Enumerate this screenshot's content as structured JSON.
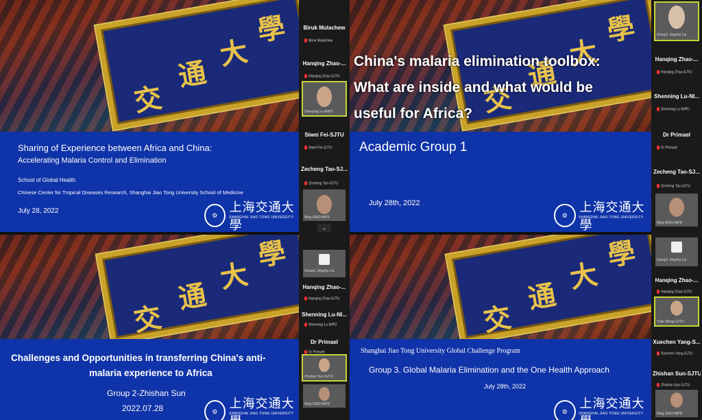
{
  "slides": {
    "s1": {
      "plaque_chars": [
        "交",
        "通",
        "大",
        "學"
      ],
      "title_line1": "Sharing of Experience between Africa and China:",
      "title_line2": "Accelerating Malaria Control and Elimination",
      "org1": "School of Global Health",
      "org2": "Chinese Center for Tropical Diseases Research, Shanghai Jiao Tong University School of Medicine",
      "date": "July 28, 2022",
      "logo_cn": "上海交通大學",
      "logo_en": "SHANGHAI JIAO TONG UNIVERSITY"
    },
    "s2": {
      "plaque_chars": [
        "交",
        "通",
        "大",
        "學"
      ],
      "overlay_line1": "China's malaria elimination toolbox:",
      "overlay_line2": "What are inside and what would be",
      "overlay_line3": "useful for Africa?",
      "group": "Academic Group 1",
      "date": "July 28th, 2022",
      "logo_cn": "上海交通大學",
      "logo_en": "SHANGHAI JIAO TONG UNIVERSITY"
    },
    "s3": {
      "plaque_chars": [
        "交",
        "通",
        "大",
        "學"
      ],
      "title_line1": "Challenges and Opportunities in transferring China's anti-",
      "title_line2": "malaria experience to Africa",
      "presenter": "Group 2-Zhishan Sun",
      "date": "2022.07.28",
      "logo_cn": "上海交通大學",
      "logo_en": "SHANGHAI JIAO TONG UNIVERSITY"
    },
    "s4": {
      "plaque_chars": [
        "交",
        "通",
        "大",
        "學"
      ],
      "program": "Shanghai Jiao Tong University Global Challenge Program",
      "title": "Group 3. Global Malaria Elimination and the One Health Approach",
      "date": "July 28th, 2022",
      "logo_cn": "上海交通大學",
      "logo_en": "SHANGHAI JIAO TONG UNIVERSITY"
    }
  },
  "strip1": {
    "participants": [
      {
        "name": "Biruk Mulachew",
        "label": "Biruk Mulachew"
      },
      {
        "name": "Hanqing Zhao-...",
        "label": "Hanqing Zhao-SJTU"
      },
      {
        "label": "Shenning Lu-NIPD"
      },
      {
        "name": "Siwei Fei-SJTU",
        "label": "Siwei Fei-SJTU"
      },
      {
        "name": "Zecheng Tao-SJ...",
        "label": "Zecheng Tao-SJTU"
      },
      {
        "label": "Ning XIAO-NIPD"
      },
      {
        "label": "Group1 Jingshu Liu"
      },
      {
        "name": "Hanqing Zhao-...",
        "label": "Hanqing Zhao-SJTU"
      },
      {
        "name": "Shenning Lu-NI...",
        "label": "Shenning Lu-NIPD"
      },
      {
        "name": "Dr Primael",
        "label": "Dr Primael"
      },
      {
        "label": "Zhishan Sun-SJTU"
      },
      {
        "label": "Ning XIAO-NIPD"
      }
    ],
    "scroll_glyph": "⌄"
  },
  "strip2": {
    "participants": [
      {
        "label": "Group1 Jingshu Liu"
      },
      {
        "name": "Hanqing Zhao-...",
        "label": "Hanqing Zhao-SJTU"
      },
      {
        "name": "Shenning Lu-NI...",
        "label": "Shenning Lu-NIPD"
      },
      {
        "name": "Dr Primael",
        "label": "Dr Primael"
      },
      {
        "name": "Zecheng Tao-SJ...",
        "label": "Zecheng Tao-SJTU"
      },
      {
        "label": "Ning XIAO-NIPD"
      },
      {
        "label": "Group1 Jingshu Liu"
      },
      {
        "name": "Hanqing Zhao-...",
        "label": "Hanqing Zhao-SJTU"
      },
      {
        "label": "Yuke Wang-SJTU"
      },
      {
        "name": "Xuechen Yang-S...",
        "label": "Xuechen Yang-SJTU"
      },
      {
        "name": "Zhishan Sun-SJTU",
        "label": "Zhishan Sun-SJTU"
      },
      {
        "label": "Ning XIAO-NIPD"
      }
    ]
  },
  "colors": {
    "slide_blue": "#0f33a8",
    "plaque_gold": "#c9a227",
    "active_outline": "#c8d43a"
  }
}
